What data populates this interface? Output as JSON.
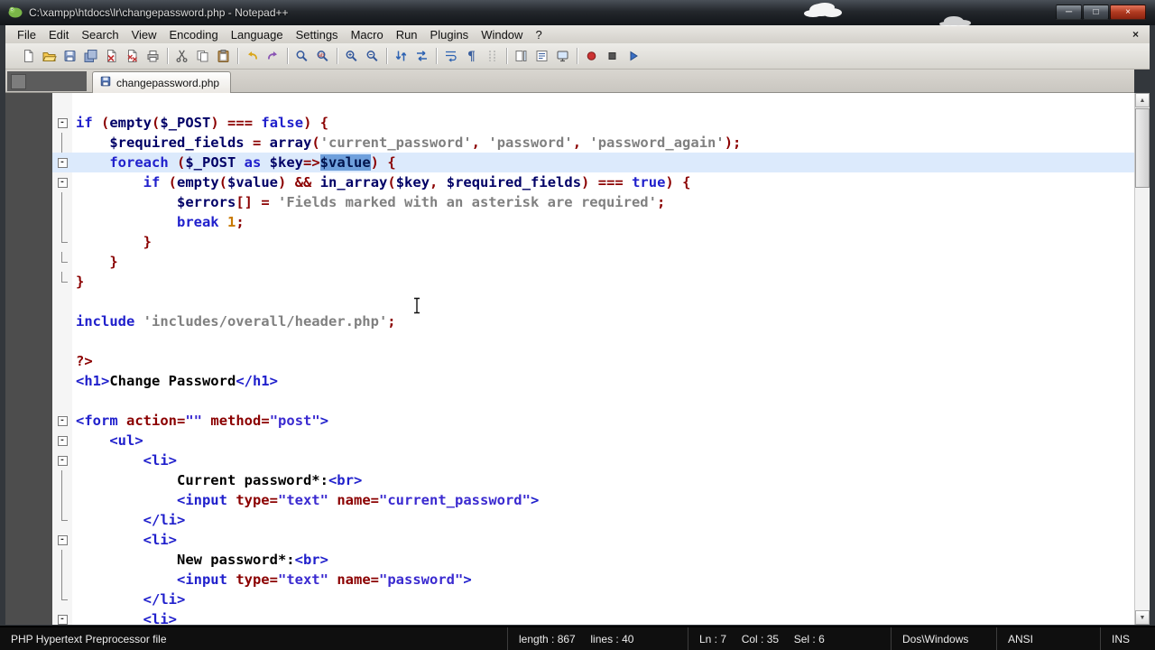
{
  "window": {
    "title": "C:\\xampp\\htdocs\\lr\\changepassword.php - Notepad++"
  },
  "window_controls": {
    "minimize": "─",
    "maximize": "□",
    "close": "×"
  },
  "menubar": {
    "items": [
      "File",
      "Edit",
      "Search",
      "View",
      "Encoding",
      "Language",
      "Settings",
      "Macro",
      "Run",
      "Plugins",
      "Window",
      "?"
    ],
    "close_glyph": "×"
  },
  "toolbar": {
    "groups": [
      [
        "new-file",
        "open-file",
        "save",
        "save-all",
        "close",
        "close-all",
        "print"
      ],
      [
        "cut",
        "copy",
        "paste"
      ],
      [
        "undo",
        "redo"
      ],
      [
        "find",
        "replace"
      ],
      [
        "zoom-in",
        "zoom-out"
      ],
      [
        "sync-vertical",
        "sync-horizontal"
      ],
      [
        "word-wrap",
        "show-all-chars",
        "indent-guide"
      ],
      [
        "doc-map",
        "function-list",
        "monitor"
      ],
      [
        "record-macro",
        "stop-macro",
        "play-macro"
      ]
    ]
  },
  "tabs": [
    {
      "label": "changepassword.php",
      "active": true,
      "saved": true
    }
  ],
  "scrollbar": {
    "up_glyph": "▲",
    "down_glyph": "▼"
  },
  "editor": {
    "fold_collapsed_glyph": "-",
    "lines": [
      {
        "fold": "start",
        "seg": [
          [
            "kw",
            "if "
          ],
          [
            "op",
            "("
          ],
          [
            "id",
            "empty"
          ],
          [
            "op",
            "("
          ],
          [
            "id",
            "$_POST"
          ],
          [
            "op",
            ")"
          ],
          [
            "txt",
            " "
          ],
          [
            "op",
            "==="
          ],
          [
            "txt",
            " "
          ],
          [
            "kw",
            "false"
          ],
          [
            "op",
            ")"
          ],
          [
            "txt",
            " "
          ],
          [
            "op",
            "{"
          ]
        ]
      },
      {
        "fold": "mid",
        "seg": [
          [
            "txt",
            "    "
          ],
          [
            "id",
            "$required_fields"
          ],
          [
            "txt",
            " "
          ],
          [
            "op",
            "="
          ],
          [
            "txt",
            " "
          ],
          [
            "id",
            "array"
          ],
          [
            "op",
            "("
          ],
          [
            "str",
            "'current_password'"
          ],
          [
            "op",
            ","
          ],
          [
            "txt",
            " "
          ],
          [
            "str",
            "'password'"
          ],
          [
            "op",
            ","
          ],
          [
            "txt",
            " "
          ],
          [
            "str",
            "'password_again'"
          ],
          [
            "op",
            ");"
          ]
        ]
      },
      {
        "fold": "start",
        "current": true,
        "seg": [
          [
            "txt",
            "    "
          ],
          [
            "kw",
            "foreach "
          ],
          [
            "op",
            "("
          ],
          [
            "id",
            "$_POST"
          ],
          [
            "txt",
            " "
          ],
          [
            "kw",
            "as "
          ],
          [
            "id",
            "$key"
          ],
          [
            "op",
            "=>"
          ],
          [
            "sel",
            "$value"
          ],
          [
            "op",
            ")"
          ],
          [
            "txt",
            " "
          ],
          [
            "op",
            "{"
          ]
        ]
      },
      {
        "fold": "start",
        "seg": [
          [
            "txt",
            "        "
          ],
          [
            "kw",
            "if "
          ],
          [
            "op",
            "("
          ],
          [
            "id",
            "empty"
          ],
          [
            "op",
            "("
          ],
          [
            "id",
            "$value"
          ],
          [
            "op",
            ")"
          ],
          [
            "txt",
            " "
          ],
          [
            "op",
            "&&"
          ],
          [
            "txt",
            " "
          ],
          [
            "id",
            "in_array"
          ],
          [
            "op",
            "("
          ],
          [
            "id",
            "$key"
          ],
          [
            "op",
            ","
          ],
          [
            "txt",
            " "
          ],
          [
            "id",
            "$required_fields"
          ],
          [
            "op",
            ")"
          ],
          [
            "txt",
            " "
          ],
          [
            "op",
            "==="
          ],
          [
            "txt",
            " "
          ],
          [
            "kw",
            "true"
          ],
          [
            "op",
            ")"
          ],
          [
            "txt",
            " "
          ],
          [
            "op",
            "{"
          ]
        ]
      },
      {
        "fold": "mid",
        "seg": [
          [
            "txt",
            "            "
          ],
          [
            "id",
            "$errors"
          ],
          [
            "op",
            "[]"
          ],
          [
            "txt",
            " "
          ],
          [
            "op",
            "="
          ],
          [
            "txt",
            " "
          ],
          [
            "str",
            "'Fields marked with an asterisk are required'"
          ],
          [
            "op",
            ";"
          ]
        ]
      },
      {
        "fold": "mid",
        "seg": [
          [
            "txt",
            "            "
          ],
          [
            "kw",
            "break "
          ],
          [
            "num",
            "1"
          ],
          [
            "op",
            ";"
          ]
        ]
      },
      {
        "fold": "end",
        "seg": [
          [
            "txt",
            "        "
          ],
          [
            "op",
            "}"
          ]
        ]
      },
      {
        "fold": "end",
        "seg": [
          [
            "txt",
            "    "
          ],
          [
            "op",
            "}"
          ]
        ]
      },
      {
        "fold": "end",
        "seg": [
          [
            "op",
            "}"
          ]
        ]
      },
      {
        "seg": []
      },
      {
        "seg": [
          [
            "kw",
            "include "
          ],
          [
            "str",
            "'includes/overall/header.php'"
          ],
          [
            "op",
            ";"
          ]
        ]
      },
      {
        "seg": []
      },
      {
        "seg": [
          [
            "op",
            "?>"
          ]
        ]
      },
      {
        "seg": [
          [
            "tag",
            "<h1>"
          ],
          [
            "txt",
            "Change Password"
          ],
          [
            "tag",
            "</h1>"
          ]
        ]
      },
      {
        "seg": []
      },
      {
        "fold": "start",
        "seg": [
          [
            "tag",
            "<form "
          ],
          [
            "attr",
            "action"
          ],
          [
            "op",
            "="
          ],
          [
            "val",
            "\"\""
          ],
          [
            "txt",
            " "
          ],
          [
            "attr",
            "method"
          ],
          [
            "op",
            "="
          ],
          [
            "val",
            "\"post\""
          ],
          [
            "tag",
            ">"
          ]
        ]
      },
      {
        "fold": "start",
        "seg": [
          [
            "txt",
            "    "
          ],
          [
            "tag",
            "<ul>"
          ]
        ]
      },
      {
        "fold": "start",
        "seg": [
          [
            "txt",
            "        "
          ],
          [
            "tag",
            "<li>"
          ]
        ]
      },
      {
        "fold": "mid",
        "seg": [
          [
            "txt",
            "            Current password*:"
          ],
          [
            "tag",
            "<br>"
          ]
        ]
      },
      {
        "fold": "mid",
        "seg": [
          [
            "txt",
            "            "
          ],
          [
            "tag",
            "<input "
          ],
          [
            "attr",
            "type"
          ],
          [
            "op",
            "="
          ],
          [
            "val",
            "\"text\""
          ],
          [
            "txt",
            " "
          ],
          [
            "attr",
            "name"
          ],
          [
            "op",
            "="
          ],
          [
            "val",
            "\"current_password\""
          ],
          [
            "tag",
            ">"
          ]
        ]
      },
      {
        "fold": "end",
        "seg": [
          [
            "txt",
            "        "
          ],
          [
            "tag",
            "</li>"
          ]
        ]
      },
      {
        "fold": "start",
        "seg": [
          [
            "txt",
            "        "
          ],
          [
            "tag",
            "<li>"
          ]
        ]
      },
      {
        "fold": "mid",
        "seg": [
          [
            "txt",
            "            New password*:"
          ],
          [
            "tag",
            "<br>"
          ]
        ]
      },
      {
        "fold": "mid",
        "seg": [
          [
            "txt",
            "            "
          ],
          [
            "tag",
            "<input "
          ],
          [
            "attr",
            "type"
          ],
          [
            "op",
            "="
          ],
          [
            "val",
            "\"text\""
          ],
          [
            "txt",
            " "
          ],
          [
            "attr",
            "name"
          ],
          [
            "op",
            "="
          ],
          [
            "val",
            "\"password\""
          ],
          [
            "tag",
            ">"
          ]
        ]
      },
      {
        "fold": "end",
        "seg": [
          [
            "txt",
            "        "
          ],
          [
            "tag",
            "</li>"
          ]
        ]
      },
      {
        "fold": "start",
        "seg": [
          [
            "txt",
            "        "
          ],
          [
            "tag",
            "<li>"
          ]
        ]
      }
    ]
  },
  "statusbar": {
    "doc_type": "PHP Hypertext Preprocessor file",
    "length_lines": "length : 867     lines : 40",
    "cursor": "Ln : 7     Col : 35     Sel : 6",
    "eol": "Dos\\Windows",
    "encoding": "ANSI",
    "insert_mode": "INS"
  }
}
